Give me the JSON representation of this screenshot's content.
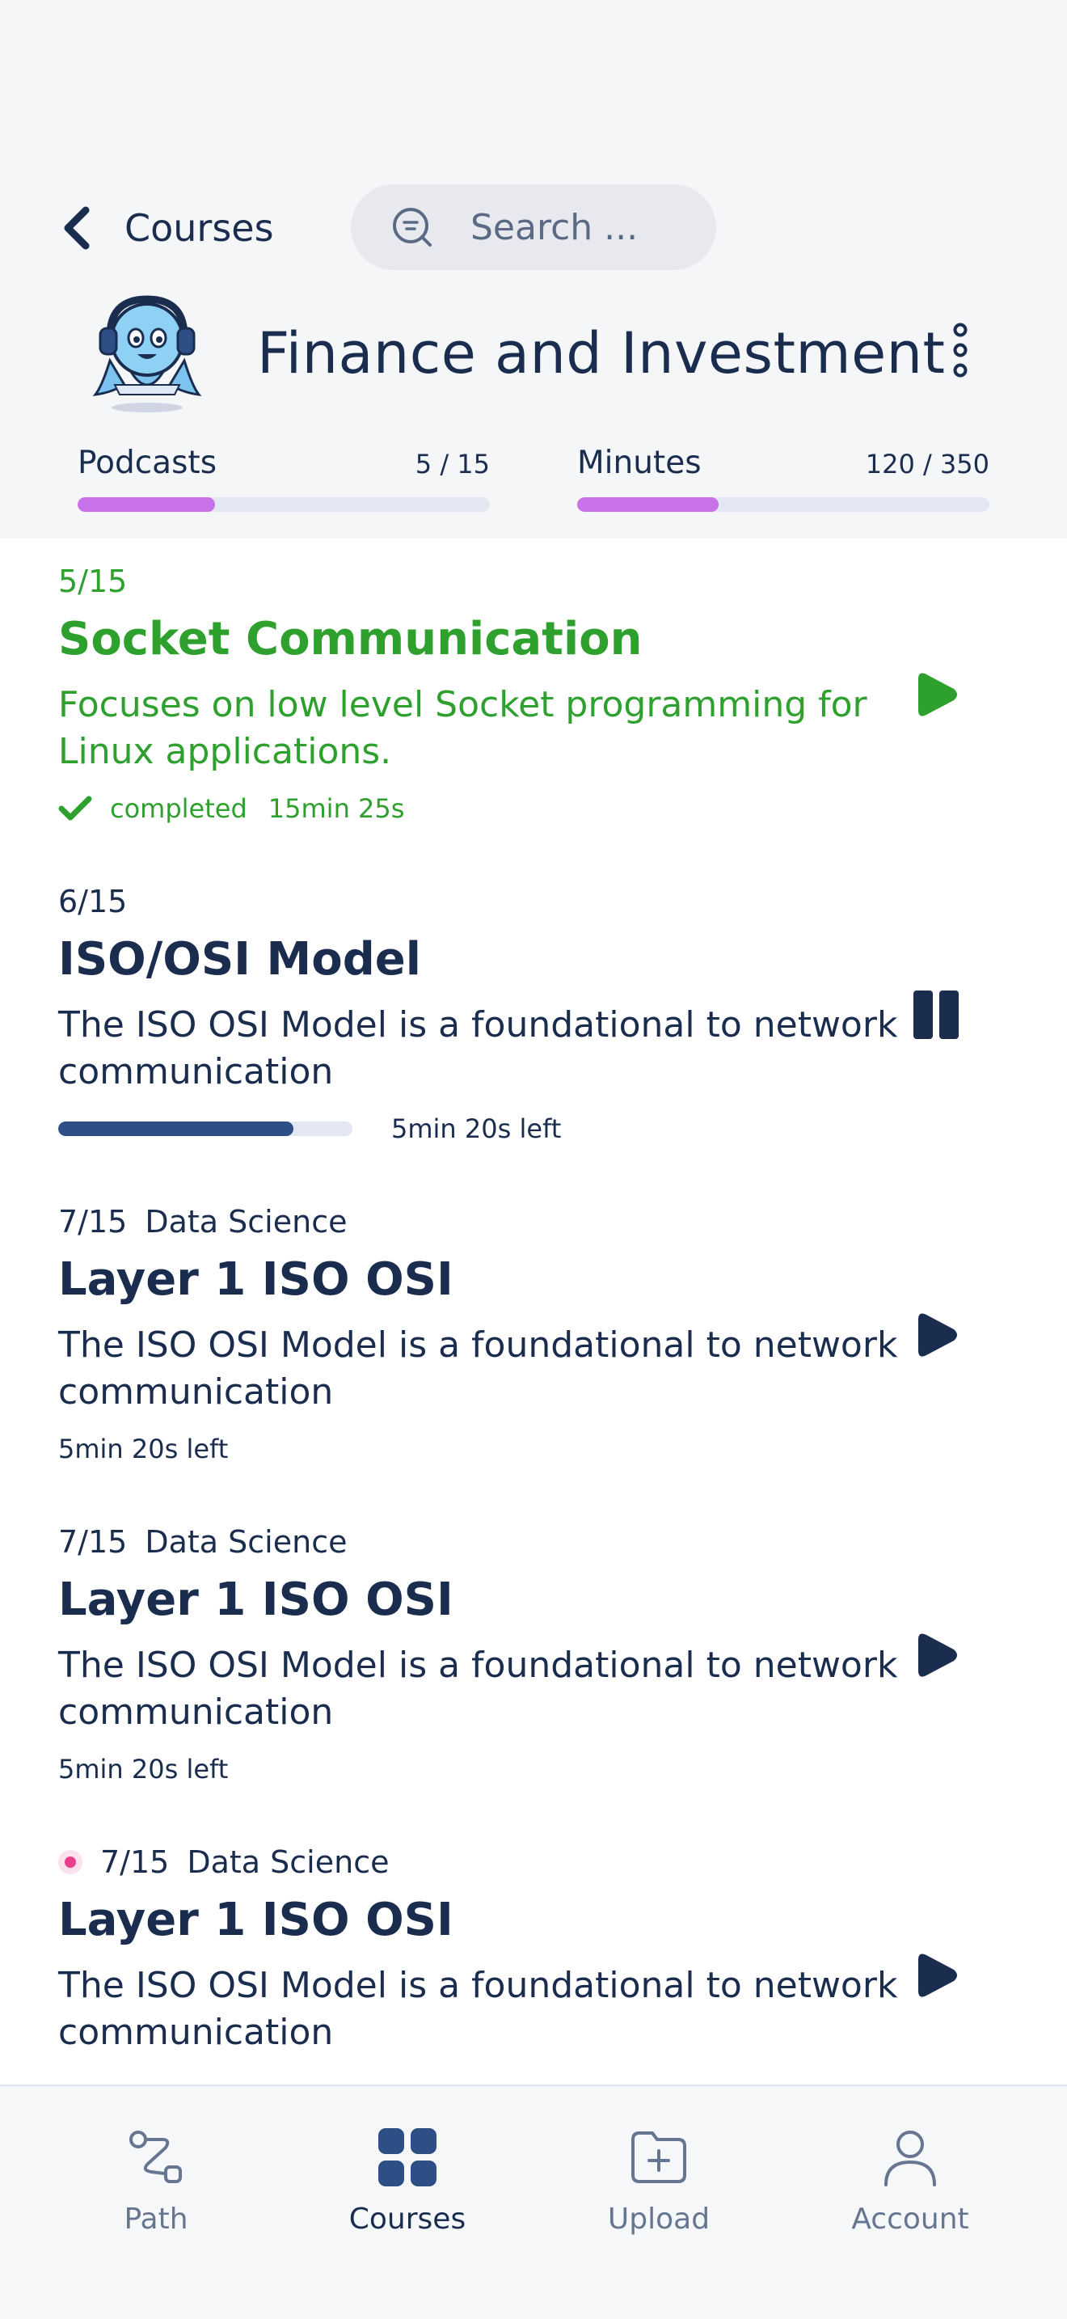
{
  "header": {
    "back_label": "Courses",
    "search_placeholder": "Search ...",
    "course_title": "Finance and Investment"
  },
  "stats": [
    {
      "label": "Podcasts",
      "value_text": "5 / 15",
      "current": 5,
      "total": 15
    },
    {
      "label": "Minutes",
      "value_text": "120 / 350",
      "current": 120,
      "total": 350
    }
  ],
  "episodes": [
    {
      "number": "5/15",
      "category": "",
      "title": "Socket Communication",
      "description": "Focuses on low level Socket programming for Linux applications.",
      "status_label": "completed",
      "duration": "15min 25s",
      "state": "completed",
      "action": "play-icon"
    },
    {
      "number": "6/15",
      "category": "",
      "title": "ISO/OSI Model",
      "description": "The ISO OSI Model is a foundational to network communication",
      "time_left": "5min 20s left",
      "progress": 0.8,
      "state": "playing",
      "action": "pause-icon"
    },
    {
      "number": "7/15",
      "category": "Data Science",
      "title": "Layer 1 ISO OSI",
      "description": "The ISO OSI Model is a foundational to network communication",
      "time_left": "5min 20s left",
      "state": "idle",
      "action": "play-icon"
    },
    {
      "number": "7/15",
      "category": "Data Science",
      "title": "Layer 1 ISO OSI",
      "description": "The ISO OSI Model is a foundational to network communication",
      "time_left": "5min 20s left",
      "state": "idle",
      "action": "play-icon"
    },
    {
      "number": "7/15",
      "category": "Data Science",
      "title": "Layer 1 ISO OSI",
      "description": "The ISO OSI Model is a foundational to network communication",
      "state": "new",
      "action": "play-icon"
    }
  ],
  "nav": [
    {
      "label": "Path",
      "icon": "path-icon",
      "active": false
    },
    {
      "label": "Courses",
      "icon": "grid-icon",
      "active": true
    },
    {
      "label": "Upload",
      "icon": "folder-plus-icon",
      "active": false
    },
    {
      "label": "Account",
      "icon": "person-icon",
      "active": false
    }
  ],
  "colors": {
    "primary": "#1b2d4f",
    "completed": "#2ea02e",
    "progress_stat": "#c772e9",
    "progress_episode": "#2d4f86",
    "new_dot": "#ea3f8b"
  }
}
